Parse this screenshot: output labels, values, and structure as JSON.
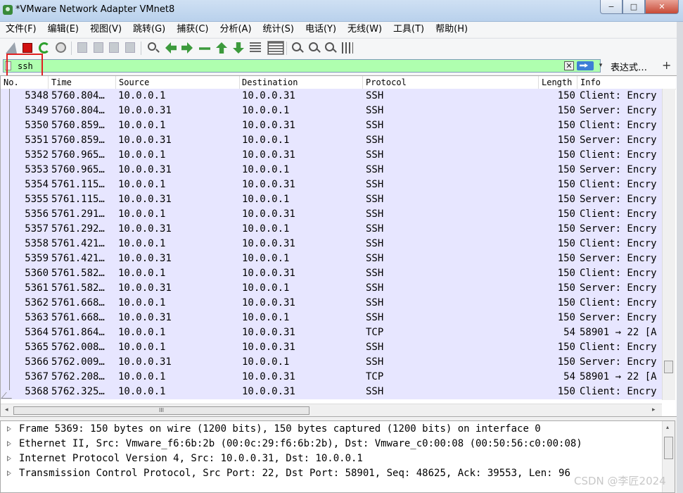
{
  "window": {
    "title": "*VMware Network Adapter VMnet8",
    "controls": {
      "minimize": "−",
      "maximize": "□",
      "close": "✕"
    }
  },
  "menu": [
    "文件(F)",
    "编辑(E)",
    "视图(V)",
    "跳转(G)",
    "捕获(C)",
    "分析(A)",
    "统计(S)",
    "电话(Y)",
    "无线(W)",
    "工具(T)",
    "帮助(H)"
  ],
  "toolbar": {
    "icons": [
      "shark-fin-icon",
      "stop-capture-icon",
      "restart-capture-icon",
      "capture-options-icon",
      "open-file-icon",
      "save-file-icon",
      "close-file-icon",
      "reload-file-icon",
      "find-packet-icon",
      "go-back-icon",
      "go-forward-icon",
      "go-to-packet-icon",
      "first-packet-icon",
      "last-packet-icon",
      "autoscroll-icon",
      "colorize-icon",
      "zoom-in-icon",
      "zoom-out-icon",
      "zoom-normal-icon",
      "resize-columns-icon"
    ]
  },
  "filter": {
    "value": "ssh",
    "clear_label": "✕",
    "dropdown_label": "▾",
    "expression_label": "表达式…",
    "add_label": "+",
    "background_color": "#afffaf"
  },
  "packet_list": {
    "columns": [
      "No.",
      "Time",
      "Source",
      "Destination",
      "Protocol",
      "Length",
      "Info"
    ],
    "rows": [
      {
        "no": "5348",
        "time": "5760.804…",
        "src": "10.0.0.1",
        "dst": "10.0.0.31",
        "proto": "SSH",
        "len": "150",
        "info": "Client: Encry"
      },
      {
        "no": "5349",
        "time": "5760.804…",
        "src": "10.0.0.31",
        "dst": "10.0.0.1",
        "proto": "SSH",
        "len": "150",
        "info": "Server: Encry"
      },
      {
        "no": "5350",
        "time": "5760.859…",
        "src": "10.0.0.1",
        "dst": "10.0.0.31",
        "proto": "SSH",
        "len": "150",
        "info": "Client: Encry"
      },
      {
        "no": "5351",
        "time": "5760.859…",
        "src": "10.0.0.31",
        "dst": "10.0.0.1",
        "proto": "SSH",
        "len": "150",
        "info": "Server: Encry"
      },
      {
        "no": "5352",
        "time": "5760.965…",
        "src": "10.0.0.1",
        "dst": "10.0.0.31",
        "proto": "SSH",
        "len": "150",
        "info": "Client: Encry"
      },
      {
        "no": "5353",
        "time": "5760.965…",
        "src": "10.0.0.31",
        "dst": "10.0.0.1",
        "proto": "SSH",
        "len": "150",
        "info": "Server: Encry"
      },
      {
        "no": "5354",
        "time": "5761.115…",
        "src": "10.0.0.1",
        "dst": "10.0.0.31",
        "proto": "SSH",
        "len": "150",
        "info": "Client: Encry"
      },
      {
        "no": "5355",
        "time": "5761.115…",
        "src": "10.0.0.31",
        "dst": "10.0.0.1",
        "proto": "SSH",
        "len": "150",
        "info": "Server: Encry"
      },
      {
        "no": "5356",
        "time": "5761.291…",
        "src": "10.0.0.1",
        "dst": "10.0.0.31",
        "proto": "SSH",
        "len": "150",
        "info": "Client: Encry"
      },
      {
        "no": "5357",
        "time": "5761.292…",
        "src": "10.0.0.31",
        "dst": "10.0.0.1",
        "proto": "SSH",
        "len": "150",
        "info": "Server: Encry"
      },
      {
        "no": "5358",
        "time": "5761.421…",
        "src": "10.0.0.1",
        "dst": "10.0.0.31",
        "proto": "SSH",
        "len": "150",
        "info": "Client: Encry"
      },
      {
        "no": "5359",
        "time": "5761.421…",
        "src": "10.0.0.31",
        "dst": "10.0.0.1",
        "proto": "SSH",
        "len": "150",
        "info": "Server: Encry"
      },
      {
        "no": "5360",
        "time": "5761.582…",
        "src": "10.0.0.1",
        "dst": "10.0.0.31",
        "proto": "SSH",
        "len": "150",
        "info": "Client: Encry"
      },
      {
        "no": "5361",
        "time": "5761.582…",
        "src": "10.0.0.31",
        "dst": "10.0.0.1",
        "proto": "SSH",
        "len": "150",
        "info": "Server: Encry"
      },
      {
        "no": "5362",
        "time": "5761.668…",
        "src": "10.0.0.1",
        "dst": "10.0.0.31",
        "proto": "SSH",
        "len": "150",
        "info": "Client: Encry"
      },
      {
        "no": "5363",
        "time": "5761.668…",
        "src": "10.0.0.31",
        "dst": "10.0.0.1",
        "proto": "SSH",
        "len": "150",
        "info": "Server: Encry"
      },
      {
        "no": "5364",
        "time": "5761.864…",
        "src": "10.0.0.1",
        "dst": "10.0.0.31",
        "proto": "TCP",
        "len": "54",
        "info": "58901 → 22 [A"
      },
      {
        "no": "5365",
        "time": "5762.008…",
        "src": "10.0.0.1",
        "dst": "10.0.0.31",
        "proto": "SSH",
        "len": "150",
        "info": "Client: Encry"
      },
      {
        "no": "5366",
        "time": "5762.009…",
        "src": "10.0.0.31",
        "dst": "10.0.0.1",
        "proto": "SSH",
        "len": "150",
        "info": "Server: Encry"
      },
      {
        "no": "5367",
        "time": "5762.208…",
        "src": "10.0.0.1",
        "dst": "10.0.0.31",
        "proto": "TCP",
        "len": "54",
        "info": "58901 → 22 [A"
      },
      {
        "no": "5368",
        "time": "5762.325…",
        "src": "10.0.0.1",
        "dst": "10.0.0.31",
        "proto": "SSH",
        "len": "150",
        "info": "Client: Encry"
      }
    ],
    "row_color": "#e7e6ff",
    "hscroll_grip": "III"
  },
  "details": [
    "Frame 5369: 150 bytes on wire (1200 bits), 150 bytes captured (1200 bits) on interface 0",
    "Ethernet II, Src: Vmware_f6:6b:2b (00:0c:29:f6:6b:2b), Dst: Vmware_c0:00:08 (00:50:56:c0:00:08)",
    "Internet Protocol Version 4, Src: 10.0.0.31, Dst: 10.0.0.1",
    "Transmission Control Protocol, Src Port: 22, Dst Port: 58901, Seq: 48625, Ack: 39553, Len: 96"
  ],
  "watermark": "CSDN @李匠2024"
}
